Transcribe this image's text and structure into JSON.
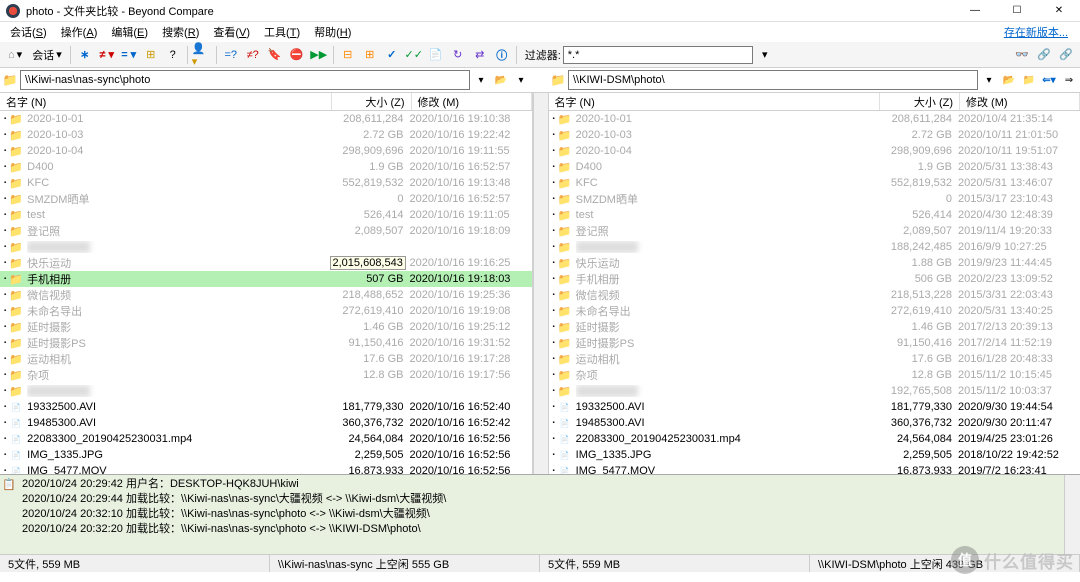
{
  "window": {
    "title": "photo - 文件夹比较 - Beyond Compare"
  },
  "menu": {
    "items": [
      {
        "label": "会话",
        "acc": "S"
      },
      {
        "label": "操作",
        "acc": "A"
      },
      {
        "label": "编辑",
        "acc": "E"
      },
      {
        "label": "搜索",
        "acc": "R"
      },
      {
        "label": "查看",
        "acc": "V"
      },
      {
        "label": "工具",
        "acc": "T"
      },
      {
        "label": "帮助",
        "acc": "H"
      }
    ],
    "new_version": "存在新版本..."
  },
  "toolbar": {
    "session_label": "会话",
    "filter_label": "过滤器:",
    "filter_value": "*.*"
  },
  "paths": {
    "left": "\\\\Kiwi-nas\\nas-sync\\photo",
    "right": "\\\\KIWI-DSM\\photo\\"
  },
  "columns": {
    "name": "名字 (N)",
    "size": "大小 (Z)",
    "date": "修改 (M)"
  },
  "left_rows": [
    {
      "t": "folder",
      "n": "2020-10-01",
      "s": "208,611,284",
      "d": "2020/10/16 19:10:38",
      "ghost": true
    },
    {
      "t": "folder",
      "n": "2020-10-03",
      "s": "2.72 GB",
      "d": "2020/10/16 19:22:42",
      "ghost": true
    },
    {
      "t": "folder",
      "n": "2020-10-04",
      "s": "298,909,696",
      "d": "2020/10/16 19:11:55",
      "ghost": true
    },
    {
      "t": "folder",
      "n": "D400",
      "s": "1.9 GB",
      "d": "2020/10/16 16:52:57",
      "ghost": true
    },
    {
      "t": "folder",
      "n": "KFC",
      "s": "552,819,532",
      "d": "2020/10/16 19:13:48",
      "ghost": true
    },
    {
      "t": "folder",
      "n": "SMZDM晒单",
      "s": "0",
      "d": "2020/10/16 16:52:57",
      "ghost": true
    },
    {
      "t": "folder",
      "n": "test",
      "s": "526,414",
      "d": "2020/10/16 19:11:05",
      "ghost": true
    },
    {
      "t": "folder",
      "n": "登记照",
      "s": "2,089,507",
      "d": "2020/10/16 19:18:09",
      "ghost": true
    },
    {
      "t": "blur",
      "n": "",
      "s": "",
      "d": "",
      "ghost": true
    },
    {
      "t": "folder",
      "n": "快乐运动",
      "s": "2,015,608,543",
      "d": "2020/10/16 19:16:25",
      "ghost": true,
      "sizebox": true
    },
    {
      "t": "folder",
      "n": "手机相册",
      "s": "507 GB",
      "d": "2020/10/16 19:18:03",
      "ghost": false,
      "hl": true,
      "icon": "pink"
    },
    {
      "t": "folder",
      "n": "微信视频",
      "s": "218,488,652",
      "d": "2020/10/16 19:25:36",
      "ghost": true
    },
    {
      "t": "folder",
      "n": "未命名导出",
      "s": "272,619,410",
      "d": "2020/10/16 19:19:08",
      "ghost": true
    },
    {
      "t": "folder",
      "n": "延时摄影",
      "s": "1.46 GB",
      "d": "2020/10/16 19:25:12",
      "ghost": true
    },
    {
      "t": "folder",
      "n": "延时摄影PS",
      "s": "91,150,416",
      "d": "2020/10/16 19:31:52",
      "ghost": true
    },
    {
      "t": "folder",
      "n": "运动相机",
      "s": "17.6 GB",
      "d": "2020/10/16 19:17:28",
      "ghost": true
    },
    {
      "t": "folder",
      "n": "杂项",
      "s": "12.8 GB",
      "d": "2020/10/16 19:17:56",
      "ghost": true
    },
    {
      "t": "blur",
      "n": "",
      "s": "",
      "d": "",
      "ghost": true
    },
    {
      "t": "file",
      "n": "19332500.AVI",
      "s": "181,779,330",
      "d": "2020/10/16 16:52:40",
      "ghost": false
    },
    {
      "t": "file",
      "n": "19485300.AVI",
      "s": "360,376,732",
      "d": "2020/10/16 16:52:42",
      "ghost": false
    },
    {
      "t": "file",
      "n": "22083300_20190425230031.mp4",
      "s": "24,564,084",
      "d": "2020/10/16 16:52:56",
      "ghost": false
    },
    {
      "t": "file",
      "n": "IMG_1335.JPG",
      "s": "2,259,505",
      "d": "2020/10/16 16:52:56",
      "ghost": false
    },
    {
      "t": "file",
      "n": "IMG_5477.MOV",
      "s": "16,873,933",
      "d": "2020/10/16 16:52:56",
      "ghost": false
    }
  ],
  "right_rows": [
    {
      "t": "folder",
      "n": "2020-10-01",
      "s": "208,611,284",
      "d": "2020/10/4 21:35:14",
      "ghost": true
    },
    {
      "t": "folder",
      "n": "2020-10-03",
      "s": "2.72 GB",
      "d": "2020/10/11 21:01:50",
      "ghost": true
    },
    {
      "t": "folder",
      "n": "2020-10-04",
      "s": "298,909,696",
      "d": "2020/10/11 19:51:07",
      "ghost": true
    },
    {
      "t": "folder",
      "n": "D400",
      "s": "1.9 GB",
      "d": "2020/5/31 13:38:43",
      "ghost": true
    },
    {
      "t": "folder",
      "n": "KFC",
      "s": "552,819,532",
      "d": "2020/5/31 13:46:07",
      "ghost": true
    },
    {
      "t": "folder",
      "n": "SMZDM晒单",
      "s": "0",
      "d": "2015/3/17 23:10:43",
      "ghost": true
    },
    {
      "t": "folder",
      "n": "test",
      "s": "526,414",
      "d": "2020/4/30 12:48:39",
      "ghost": true
    },
    {
      "t": "folder",
      "n": "登记照",
      "s": "2,089,507",
      "d": "2019/11/4 19:20:33",
      "ghost": true
    },
    {
      "t": "blur",
      "n": "",
      "s": "188,242,485",
      "d": "2016/9/9 10:27:25",
      "ghost": true
    },
    {
      "t": "folder",
      "n": "快乐运动",
      "s": "1.88 GB",
      "d": "2019/9/23 11:44:45",
      "ghost": true
    },
    {
      "t": "folder",
      "n": "手机相册",
      "s": "506 GB",
      "d": "2020/2/23 13:09:52",
      "ghost": true,
      "icon": "red"
    },
    {
      "t": "folder",
      "n": "微信视频",
      "s": "218,513,228",
      "d": "2015/3/31 22:03:43",
      "ghost": true
    },
    {
      "t": "folder",
      "n": "未命名导出",
      "s": "272,619,410",
      "d": "2020/5/31 13:40:25",
      "ghost": true
    },
    {
      "t": "folder",
      "n": "延时摄影",
      "s": "1.46 GB",
      "d": "2017/2/13 20:39:13",
      "ghost": true
    },
    {
      "t": "folder",
      "n": "延时摄影PS",
      "s": "91,150,416",
      "d": "2017/2/14 11:52:19",
      "ghost": true
    },
    {
      "t": "folder",
      "n": "运动相机",
      "s": "17.6 GB",
      "d": "2016/1/28 20:48:33",
      "ghost": true
    },
    {
      "t": "folder",
      "n": "杂项",
      "s": "12.8 GB",
      "d": "2015/11/2 10:15:45",
      "ghost": true
    },
    {
      "t": "blur",
      "n": "",
      "s": "192,765,508",
      "d": "2015/11/2 10:03:37",
      "ghost": true
    },
    {
      "t": "file",
      "n": "19332500.AVI",
      "s": "181,779,330",
      "d": "2020/9/30 19:44:54",
      "ghost": false
    },
    {
      "t": "file",
      "n": "19485300.AVI",
      "s": "360,376,732",
      "d": "2020/9/30 20:11:47",
      "ghost": false
    },
    {
      "t": "file",
      "n": "22083300_20190425230031.mp4",
      "s": "24,564,084",
      "d": "2019/4/25 23:01:26",
      "ghost": false
    },
    {
      "t": "file",
      "n": "IMG_1335.JPG",
      "s": "2,259,505",
      "d": "2018/10/22 19:42:52",
      "ghost": false
    },
    {
      "t": "file",
      "n": "IMG_5477.MOV",
      "s": "16,873,933",
      "d": "2019/7/2 16:23:41",
      "ghost": false
    }
  ],
  "log": [
    "2020/10/24 20:29:42  用户名：DESKTOP-HQK8JUH\\kiwi",
    "2020/10/24 20:29:44  加载比较：\\\\Kiwi-nas\\nas-sync\\大疆视频 <-> \\\\Kiwi-dsm\\大疆视频\\",
    "2020/10/24 20:32:10  加载比较：\\\\Kiwi-nas\\nas-sync\\photo <-> \\\\Kiwi-dsm\\大疆视频\\",
    "2020/10/24 20:32:20  加载比较：\\\\Kiwi-nas\\nas-sync\\photo <-> \\\\KIWI-DSM\\photo\\"
  ],
  "status": {
    "left_count": "5文件, 559 MB",
    "left_space": "\\\\Kiwi-nas\\nas-sync 上空闲 555 GB",
    "right_count": "5文件, 559 MB",
    "right_space": "\\\\KIWI-DSM\\photo 上空闲 439 GB"
  },
  "watermark": "什么值得买"
}
